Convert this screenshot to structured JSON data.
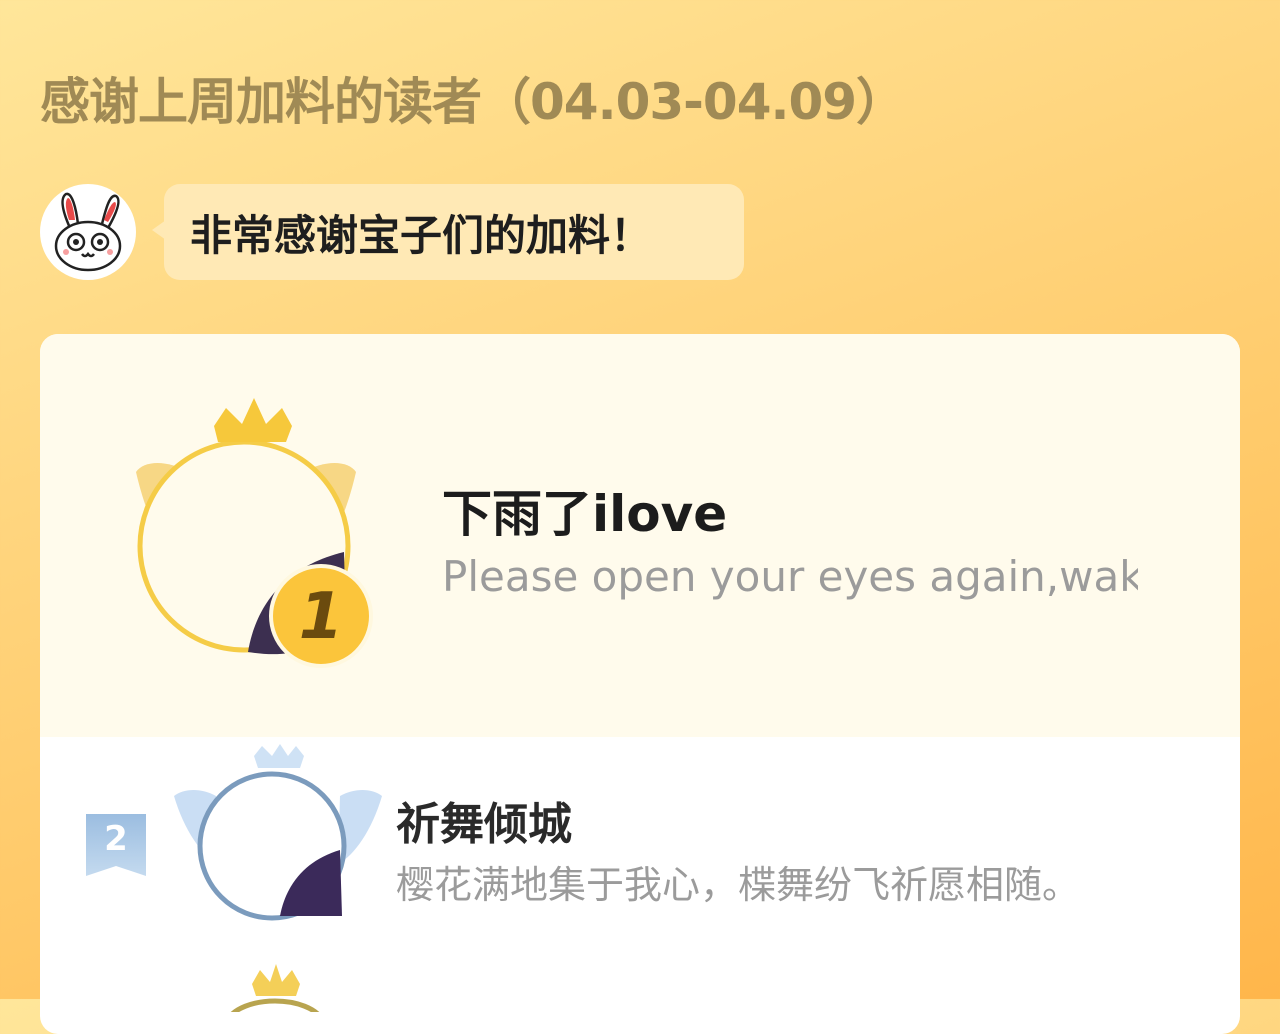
{
  "header": {
    "title": "感谢上周加料的读者（04.03-04.09）"
  },
  "greeting": {
    "mascot_icon": "rabbit-icon",
    "message": "非常感谢宝子们的加料！"
  },
  "ranking": [
    {
      "rank": "1",
      "name": "下雨了ilove",
      "description": "Please open your eyes again,wake up"
    },
    {
      "rank": "2",
      "name": "祈舞倾城",
      "description": "樱花满地集于我心，楪舞纷飞祈愿相随。"
    }
  ],
  "colors": {
    "title": "#a08a55",
    "gold": "#ffc83a",
    "silver": "#7b9bbd",
    "bronze": "#c8b25a",
    "bubble": "#ffe9b5"
  }
}
